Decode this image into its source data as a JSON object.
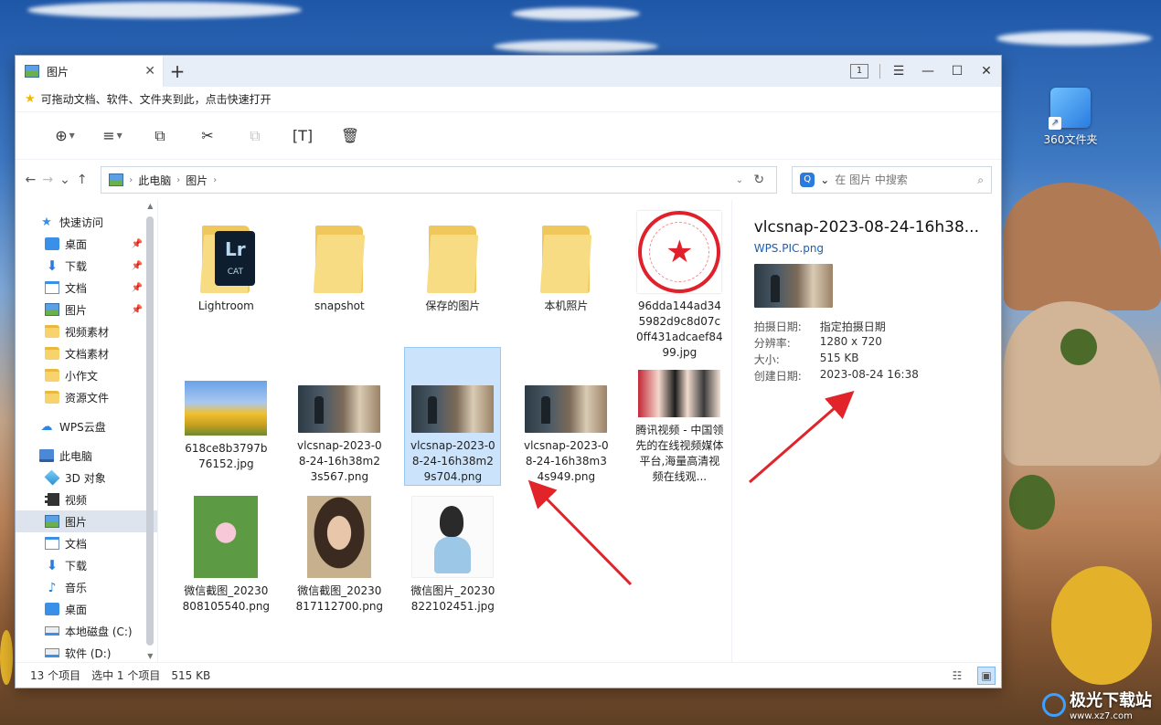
{
  "window": {
    "tab_label": "图片",
    "tab_count": "1",
    "quickbar_text": "可拖动文档、软件、文件夹到此，点击快速打开"
  },
  "address": {
    "crumbs": [
      "此电脑",
      "图片"
    ],
    "search_placeholder": "在 图片 中搜索"
  },
  "sidebar": {
    "quick_access": "快速访问",
    "quick_items": [
      "桌面",
      "下载",
      "文档",
      "图片",
      "视频素材",
      "文档素材",
      "小作文",
      "资源文件"
    ],
    "wps_cloud": "WPS云盘",
    "this_pc": "此电脑",
    "pc_items": [
      "3D 对象",
      "视频",
      "图片",
      "文档",
      "下载",
      "音乐",
      "桌面",
      "本地磁盘 (C:)",
      "软件 (D:)"
    ]
  },
  "files": [
    {
      "name": "Lightroom"
    },
    {
      "name": "snapshot"
    },
    {
      "name": "保存的图片"
    },
    {
      "name": "本机照片"
    },
    {
      "name": "96dda144ad345982d9c8d07c0ff431adcaef8499.jpg"
    },
    {
      "name": "618ce8b3797b76152.jpg"
    },
    {
      "name": "vlcsnap-2023-08-24-16h38m23s567.png"
    },
    {
      "name": "vlcsnap-2023-08-24-16h38m29s704.png"
    },
    {
      "name": "vlcsnap-2023-08-24-16h38m34s949.png"
    },
    {
      "name": "腾讯视频 - 中国领先的在线视频媒体平台,海量高清视频在线观..."
    },
    {
      "name": "微信截图_20230808105540.png"
    },
    {
      "name": "微信截图_20230817112700.png"
    },
    {
      "name": "微信图片_20230822102451.jpg"
    }
  ],
  "lightroom_badge": {
    "big": "Lr",
    "small": "CAT"
  },
  "preview": {
    "title": "vlcsnap-2023-08-24-16h38...",
    "subtitle": "WPS.PIC.png",
    "rows": [
      {
        "k": "拍摄日期:",
        "v": "指定拍摄日期"
      },
      {
        "k": "分辨率:",
        "v": "1280 x 720"
      },
      {
        "k": "大小:",
        "v": "515 KB"
      },
      {
        "k": "创建日期:",
        "v": "2023-08-24 16:38"
      }
    ]
  },
  "status": {
    "count": "13 个项目",
    "selected": "选中 1 个项目",
    "size": "515 KB"
  },
  "desktop": {
    "icon_label": "360文件夹",
    "watermark": "极光下载站",
    "watermark_sub": "www.xz7.com"
  },
  "colors": {
    "accent": "#2a7be0",
    "selection": "#cce4fb",
    "arrow": "#e0242a"
  }
}
